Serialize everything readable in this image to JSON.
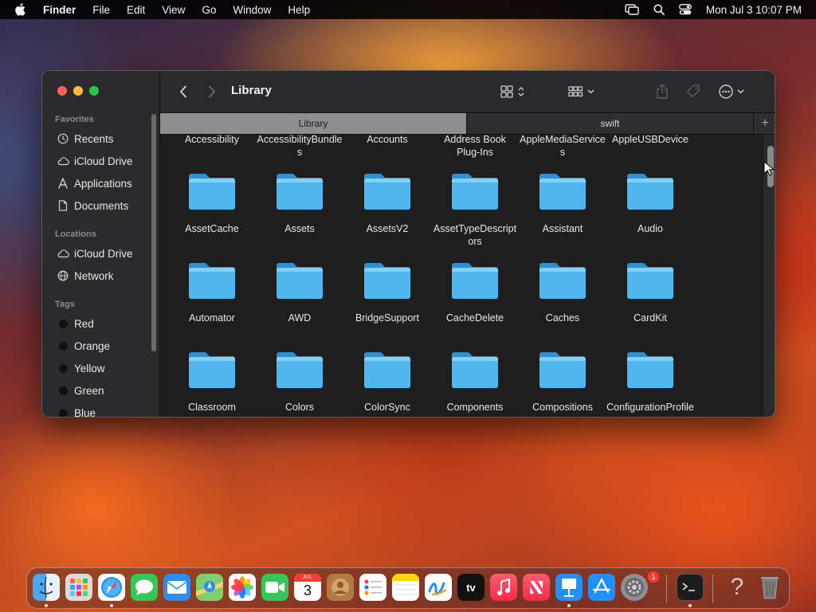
{
  "menubar": {
    "app_name": "Finder",
    "menus": [
      "File",
      "Edit",
      "View",
      "Go",
      "Window",
      "Help"
    ],
    "clock": "Mon Jul 3  10:07 PM",
    "status_icons": [
      "screen-mirroring-icon",
      "spotlight-search-icon",
      "control-center-icon"
    ]
  },
  "window": {
    "title": "Library",
    "tabs": [
      {
        "label": "Library",
        "active": true
      },
      {
        "label": "swift",
        "active": false
      }
    ],
    "new_tab_label": "+",
    "sidebar": {
      "favorites_header": "Favorites",
      "favorites": [
        {
          "label": "Recents",
          "icon": "clock-icon"
        },
        {
          "label": "iCloud Drive",
          "icon": "cloud-icon"
        },
        {
          "label": "Applications",
          "icon": "applications-icon"
        },
        {
          "label": "Documents",
          "icon": "document-icon"
        }
      ],
      "locations_header": "Locations",
      "locations": [
        {
          "label": "iCloud Drive",
          "icon": "cloud-icon"
        },
        {
          "label": "Network",
          "icon": "globe-icon"
        }
      ],
      "tags_header": "Tags",
      "tags": [
        {
          "label": "Red"
        },
        {
          "label": "Orange"
        },
        {
          "label": "Yellow"
        },
        {
          "label": "Green"
        },
        {
          "label": "Blue"
        }
      ]
    },
    "top_row_labels": [
      "Accessibility",
      "AccessibilityBundles",
      "Accounts",
      "Address Book Plug-Ins",
      "AppleMediaServices",
      "AppleUSBDevice"
    ],
    "folder_rows": [
      [
        "AssetCache",
        "Assets",
        "AssetsV2",
        "AssetTypeDescriptors",
        "Assistant",
        "Audio"
      ],
      [
        "Automator",
        "AWD",
        "BridgeSupport",
        "CacheDelete",
        "Caches",
        "CardKit"
      ],
      [
        "Classroom",
        "Colors",
        "ColorSync",
        "Components",
        "Compositions",
        "ConfigurationProfiles"
      ]
    ]
  },
  "dock": {
    "apps": [
      "Finder",
      "Launchpad",
      "Safari",
      "Messages",
      "Mail",
      "Maps",
      "Photos",
      "FaceTime",
      "Calendar",
      "Contacts",
      "Reminders",
      "Notes",
      "Freeform",
      "TV",
      "Music",
      "News",
      "Keynote",
      "App Store",
      "System Settings",
      "Terminal",
      "Help",
      "Trash"
    ],
    "calendar_month": "JUL",
    "calendar_day": "3",
    "tv_label": "tv",
    "settings_badge": "1",
    "help_glyph": "?"
  },
  "colors": {
    "folder": "#4fb6ee",
    "accent_red": "#fe5f57",
    "accent_yellow": "#febc2e",
    "accent_green": "#28c840"
  }
}
